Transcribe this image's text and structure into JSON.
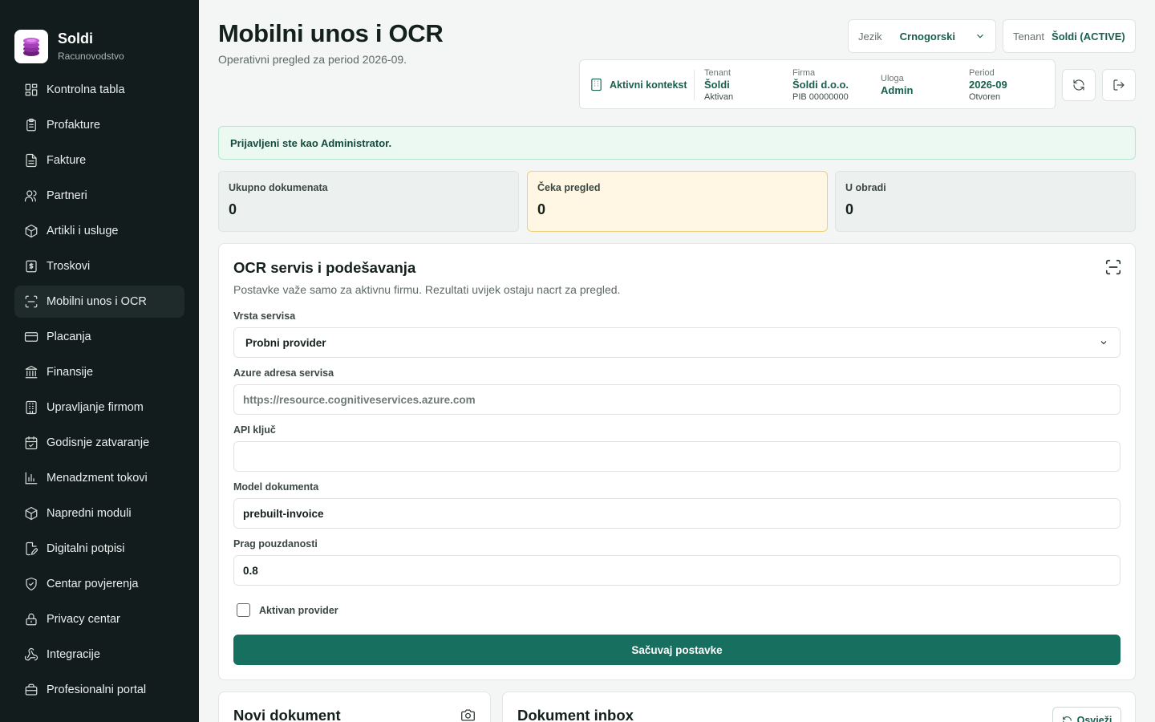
{
  "brand": {
    "name": "Soldi",
    "subtitle": "Racunovodstvo"
  },
  "sidebar": {
    "items": [
      {
        "label": "Kontrolna tabla",
        "icon": "dashboard-icon",
        "active": false
      },
      {
        "label": "Profakture",
        "icon": "clipboard-icon",
        "active": false
      },
      {
        "label": "Fakture",
        "icon": "document-icon",
        "active": false
      },
      {
        "label": "Partneri",
        "icon": "users-icon",
        "active": false
      },
      {
        "label": "Artikli i usluge",
        "icon": "package-icon",
        "active": false
      },
      {
        "label": "Troskovi",
        "icon": "receipt-icon",
        "active": false
      },
      {
        "label": "Mobilni unos i OCR",
        "icon": "scan-icon",
        "active": true
      },
      {
        "label": "Placanja",
        "icon": "credit-card-icon",
        "active": false
      },
      {
        "label": "Finansije",
        "icon": "bank-icon",
        "active": false
      },
      {
        "label": "Upravljanje firmom",
        "icon": "building-icon",
        "active": false
      },
      {
        "label": "Godisnje zatvaranje",
        "icon": "calendar-check-icon",
        "active": false
      },
      {
        "label": "Menadzment tokovi",
        "icon": "bar-chart-icon",
        "active": false
      },
      {
        "label": "Napredni moduli",
        "icon": "box-icon",
        "active": false
      },
      {
        "label": "Digitalni potpisi",
        "icon": "signature-icon",
        "active": false
      },
      {
        "label": "Centar povjerenja",
        "icon": "shield-icon",
        "active": false
      },
      {
        "label": "Privacy centar",
        "icon": "lock-icon",
        "active": false
      },
      {
        "label": "Integracije",
        "icon": "webhook-icon",
        "active": false
      },
      {
        "label": "Profesionalni portal",
        "icon": "briefcase-icon",
        "active": false
      }
    ]
  },
  "header": {
    "title": "Mobilni unos i OCR",
    "subtitle": "Operativni pregled za period 2026-09.",
    "language": {
      "label": "Jezik",
      "value": "Crnogorski"
    },
    "tenant": {
      "label": "Tenant",
      "value": "Šoldi (ACTIVE)"
    }
  },
  "context": {
    "heading": "Aktivni kontekst",
    "columns": [
      {
        "key": "Tenant",
        "value": "Šoldi",
        "sub": "Aktivan"
      },
      {
        "key": "Firma",
        "value": "Šoldi d.o.o.",
        "sub": "PIB 00000000"
      },
      {
        "key": "Uloga",
        "value": "Admin",
        "sub": ""
      },
      {
        "key": "Period",
        "value": "2026-09",
        "sub": "Otvoren"
      }
    ]
  },
  "alert": {
    "text": "Prijavljeni ste kao Administrator."
  },
  "stats": [
    {
      "label": "Ukupno dokumenata",
      "value": "0"
    },
    {
      "label": "Čeka pregled",
      "value": "0"
    },
    {
      "label": "U obradi",
      "value": "0"
    }
  ],
  "ocr_card": {
    "title": "OCR servis i podešavanja",
    "description": "Postavke važe samo za aktivnu firmu. Rezultati uvijek ostaju nacrt za pregled.",
    "service_type": {
      "label": "Vrsta servisa",
      "value": "Probni provider"
    },
    "azure_url": {
      "label": "Azure adresa servisa",
      "placeholder": "https://resource.cognitiveservices.azure.com"
    },
    "api_key": {
      "label": "API ključ",
      "value": ""
    },
    "doc_model": {
      "label": "Model dokumenta",
      "value": "prebuilt-invoice"
    },
    "confidence": {
      "label": "Prag pouzdanosti",
      "value": "0.8"
    },
    "active_provider": {
      "label": "Aktivan provider",
      "checked": false
    },
    "save_label": "Sačuvaj postavke"
  },
  "new_doc_card": {
    "title": "Novi dokument"
  },
  "inbox_card": {
    "title": "Dokument inbox",
    "refresh_label": "Osvježi"
  },
  "colors": {
    "sidebar_bg": "#131c1c",
    "accent": "#17705f",
    "warn_bg": "#fff7e3"
  }
}
